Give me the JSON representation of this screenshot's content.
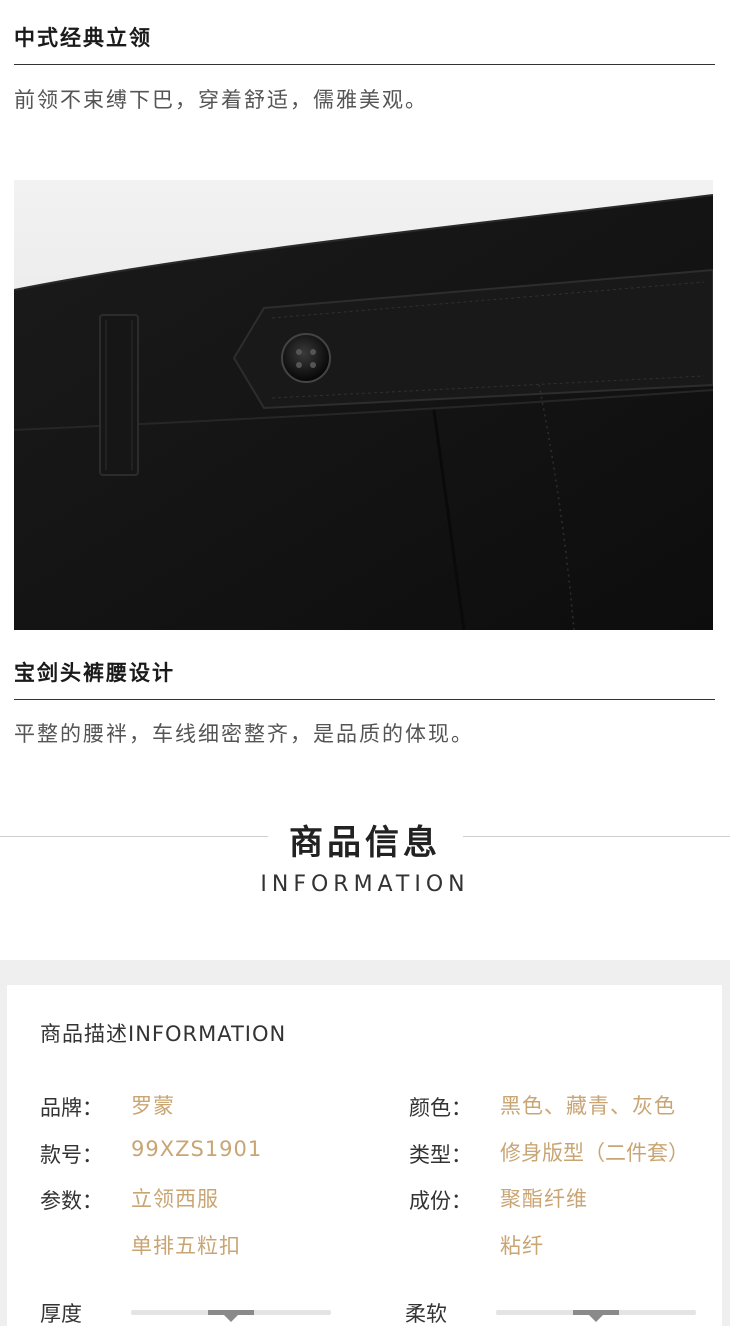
{
  "section1": {
    "title": "中式经典立领",
    "desc": "前领不束缚下巴，穿着舒适，儒雅美观。"
  },
  "section2": {
    "title": "宝剑头裤腰设计",
    "desc": "平整的腰袢，车线细密整齐，是品质的体现。"
  },
  "info_header": {
    "title": "商品信息",
    "subtitle": "INFORMATION"
  },
  "card": {
    "title": "商品描述INFORMATION",
    "left": {
      "brand_label": "品牌：",
      "brand_value": "罗蒙",
      "model_label": "款号：",
      "model_value": "99XZS1901",
      "params_label": "参数：",
      "params_value_1": "立领西服",
      "params_value_2": "单排五粒扣"
    },
    "right": {
      "color_label": "颜色：",
      "color_value": "黑色、藏青、灰色",
      "type_label": "类型：",
      "type_value": "修身版型（二件套）",
      "material_label": "成份：",
      "material_value_1": "聚酯纤维",
      "material_value_2": "粘纤"
    },
    "thickness": {
      "label": "厚度",
      "level": 0.5
    },
    "softness": {
      "label": "柔软",
      "level": 0.5
    }
  },
  "colors": {
    "accent_value": "#c9a574",
    "label": "#333333",
    "card_bg": "#efefef"
  }
}
